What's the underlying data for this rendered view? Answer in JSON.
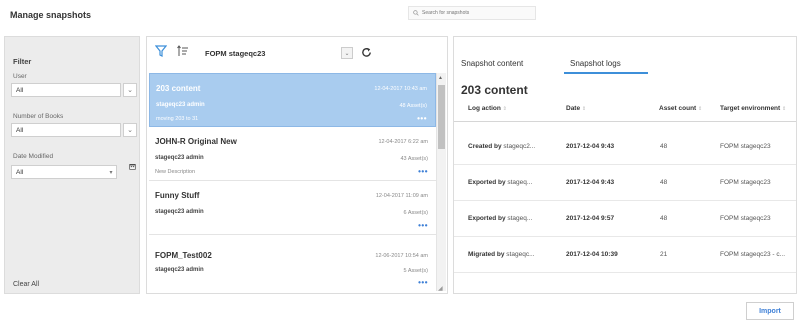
{
  "page": {
    "title": "Manage snapshots"
  },
  "search": {
    "placeholder": "Search for snapshots"
  },
  "filter": {
    "title": "Filter",
    "user_label": "User",
    "user_value": "All",
    "books_label": "Number of Books",
    "books_value": "All",
    "date_label": "Date Modified",
    "date_value": "All",
    "clear_all": "Clear All"
  },
  "list_toolbar": {
    "title": "FOPM stageqc23"
  },
  "snapshots": [
    {
      "title": "203 content",
      "date": "12-04-2017 10:43 am",
      "owner": "stageqc23 admin",
      "assets": "48 Asset(s)",
      "description": "moving 203 to 31",
      "more": "•••"
    },
    {
      "title": "JOHN-R Original New",
      "date": "12-04-2017 6:22 am",
      "owner": "stageqc23 admin",
      "assets": "43 Asset(s)",
      "description": "New Description",
      "more": "•••"
    },
    {
      "title": "Funny Stuff",
      "date": "12-04-2017 11:09 am",
      "owner": "stageqc23 admin",
      "assets": "6 Asset(s)",
      "description": "",
      "more": "•••"
    },
    {
      "title": "FOPM_Test002",
      "date": "12-06-2017 10:54 am",
      "owner": "stageqc23 admin",
      "assets": "5 Asset(s)",
      "description": "",
      "more": "•••"
    }
  ],
  "detail": {
    "tabs": {
      "content": "Snapshot content",
      "logs": "Snapshot logs"
    },
    "title": "203 content",
    "columns": {
      "action": "Log action",
      "date": "Date",
      "assets": "Asset count",
      "env": "Target environment"
    },
    "rows": [
      {
        "verb": "Created by",
        "actor": "stageqc2...",
        "date": "2017-12-04 9:43",
        "count": "48",
        "env": "FOPM stageqc23"
      },
      {
        "verb": "Exported by",
        "actor": "stageq...",
        "date": "2017-12-04 9:43",
        "count": "48",
        "env": "FOPM stageqc23"
      },
      {
        "verb": "Exported by",
        "actor": "stageq...",
        "date": "2017-12-04 9:57",
        "count": "48",
        "env": "FOPM stageqc23"
      },
      {
        "verb": "Migrated by",
        "actor": "stageqc...",
        "date": "2017-12-04 10:39",
        "count": "21",
        "env": "FOPM stageqc23 - c..."
      }
    ]
  },
  "actions": {
    "import": "Import"
  },
  "colors": {
    "accent": "#3d8fd9",
    "selected_bg": "#a9ccef"
  }
}
